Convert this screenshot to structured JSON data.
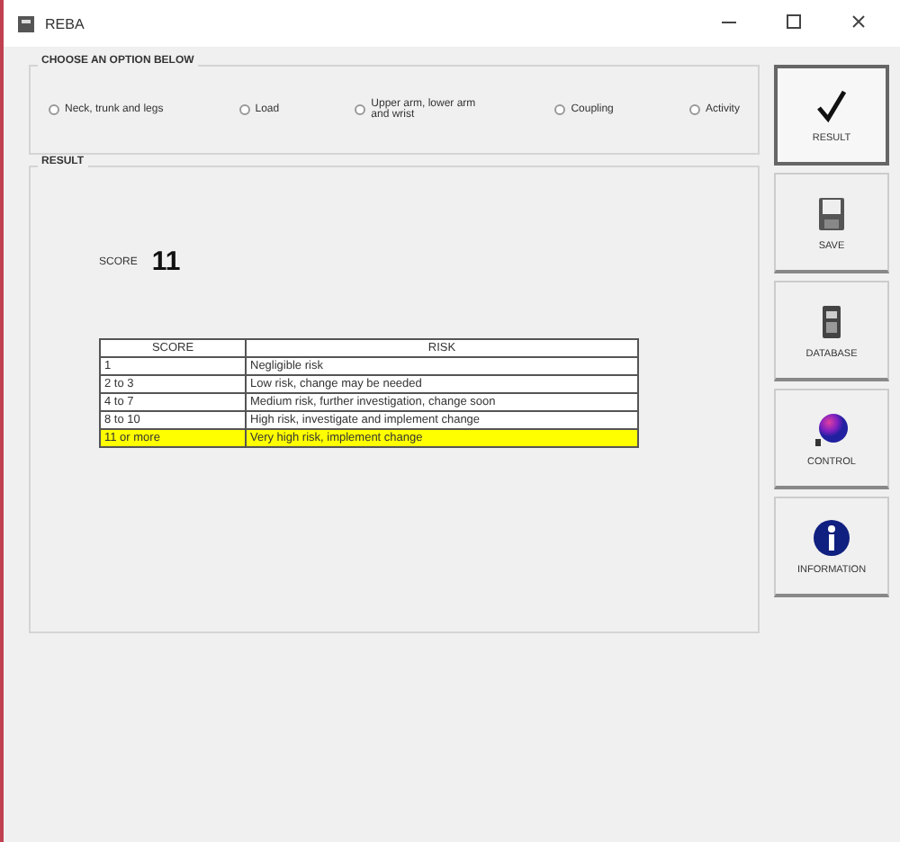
{
  "window": {
    "title": "REBA"
  },
  "options_group": {
    "title": "CHOOSE AN OPTION BELOW",
    "options": [
      {
        "label": "Neck, trunk and legs",
        "selected": false
      },
      {
        "label": "Load",
        "selected": false
      },
      {
        "label": "Upper arm, lower arm and wrist",
        "selected": false
      },
      {
        "label": "Coupling",
        "selected": false
      },
      {
        "label": "Activity",
        "selected": false
      }
    ]
  },
  "result_group": {
    "title": "RESULT",
    "score_label": "SCORE",
    "score": "11",
    "table": {
      "columns": [
        "SCORE",
        "RISK"
      ],
      "rows": [
        {
          "cells": [
            "1",
            "Negligible risk"
          ],
          "selected": false
        },
        {
          "cells": [
            "2 to 3",
            "Low risk, change may be needed"
          ],
          "selected": false
        },
        {
          "cells": [
            "4 to 7",
            "Medium risk, further investigation, change soon"
          ],
          "selected": false
        },
        {
          "cells": [
            "8 to 10",
            "High risk, investigate and implement change"
          ],
          "selected": false
        },
        {
          "cells": [
            "11 or more",
            "Very high risk, implement change"
          ],
          "selected": true
        }
      ]
    }
  },
  "buttons": [
    {
      "kind": "check",
      "label": "RESULT",
      "selected": true
    },
    {
      "kind": "disk",
      "label": "SAVE",
      "selected": false
    },
    {
      "kind": "database",
      "label": "DATABASE",
      "selected": false
    },
    {
      "kind": "palette",
      "label": "CONTROL",
      "selected": false
    },
    {
      "kind": "info",
      "label": "INFORMATION",
      "selected": false
    }
  ]
}
